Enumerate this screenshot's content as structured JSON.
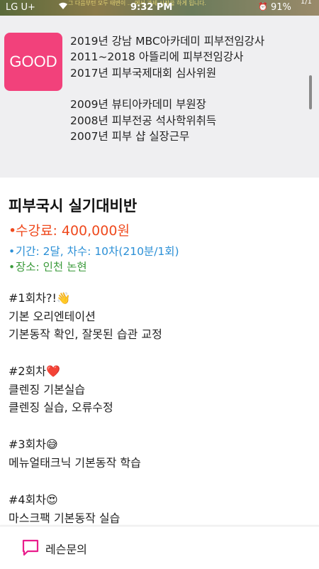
{
  "status": {
    "carrier": "LG U+",
    "time": "9:32 PM",
    "battery": "91%",
    "page": "1/1",
    "ticker": "그 다음부턴 모두 태변이 ... 에서 과제 시작을 하게 됩니다."
  },
  "badge": {
    "label": "GOOD"
  },
  "career": [
    "2019년 강남 MBC아카데미 피부전임강사",
    "2011~2018  아뜰리에 피부전임강사",
    "2017년 피부국제대회 심사위원",
    "2009년 뷰티아카데미 부원장",
    "2008년 피부전공 석사학위취득",
    "2007년 피부 샵 실장근무"
  ],
  "course": {
    "title": "피부국시 실기대비반",
    "fee": "수강료: 400,000원",
    "period": "기간: 2달,  차수: 10차(210분/1회)",
    "place": "장소: 인천 논현"
  },
  "sessions": [
    {
      "title": "#1회차?!👋",
      "lines": [
        "기본 오리엔테이션",
        "기본동작 확인, 잘못된 습관 교정"
      ]
    },
    {
      "title": "#2회차❤️",
      "lines": [
        "클렌징 기본실습",
        "클렌징 실습, 오류수정"
      ]
    },
    {
      "title": "#3회차😅",
      "lines": [
        "메뉴얼태크닉 기본동작 학습"
      ]
    },
    {
      "title": "#4회차😍",
      "lines": [
        "마스크팩 기본동작 실습"
      ]
    }
  ],
  "bottom": {
    "lesson_inquiry": "레슨문의"
  },
  "colors": {
    "badge": "#f2417b",
    "fee": "#ef4a1e",
    "period": "#2a8fd6",
    "place": "#3a9a3a"
  }
}
